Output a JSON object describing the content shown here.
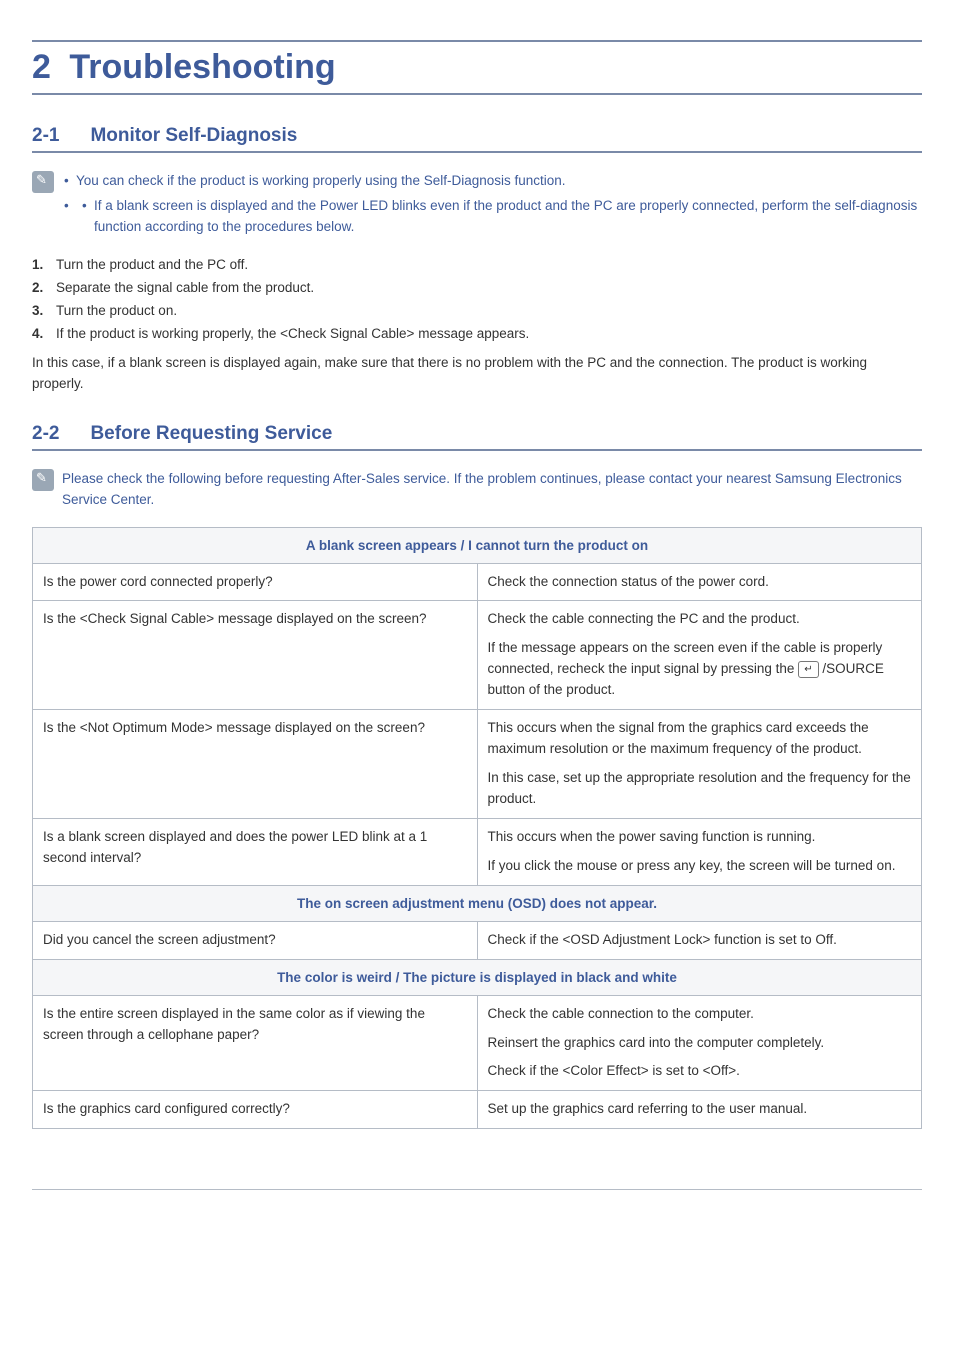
{
  "chapter": {
    "number": "2",
    "title": "Troubleshooting"
  },
  "section1": {
    "number": "2-1",
    "title": "Monitor Self-Diagnosis",
    "note_bullets": [
      "You can check if the product is working properly using the Self-Diagnosis function.",
      "If a blank screen is displayed and the Power LED blinks even if the product and the PC are properly connected, perform the self-diagnosis function according to the procedures below."
    ],
    "steps": [
      "Turn the product and the PC off.",
      "Separate the signal cable from the product.",
      "Turn the product on.",
      "If the product is working properly, the <Check Signal Cable> message appears."
    ],
    "tail": "In this case, if a blank screen is displayed again, make sure that there is no problem with the PC and the connection. The product is working properly."
  },
  "section2": {
    "number": "2-2",
    "title": "Before Requesting Service",
    "note": "Please check the following before requesting After-Sales service. If the problem continues, please contact your nearest Samsung Electronics Service Center.",
    "groups": [
      {
        "header": "A blank screen appears / I cannot turn the product on",
        "rows": [
          {
            "q": "Is the power cord connected properly?",
            "a": [
              "Check the connection status of the power cord."
            ]
          },
          {
            "q": "Is the <Check Signal Cable> message displayed on the screen?",
            "a": [
              "Check the cable connecting the PC and the product.",
              "If the message appears on the screen even if the cable is properly connected, recheck the input signal by pressing the {SOURCE} /SOURCE button of the product."
            ]
          },
          {
            "q": "Is the <Not Optimum Mode> message displayed on the screen?",
            "a": [
              "This occurs when the signal from the graphics card exceeds the maximum resolution or the maximum frequency of the product.",
              "In this case, set up the appropriate resolution and the frequency for the product."
            ]
          },
          {
            "q": "Is a blank screen displayed and does the power LED blink at a 1 second interval?",
            "a": [
              "This occurs when the power saving function is running.",
              "If you click the mouse or press any key, the screen will be turned on."
            ]
          }
        ]
      },
      {
        "header": "The on screen adjustment menu (OSD) does not appear.",
        "rows": [
          {
            "q": "Did you cancel the screen adjustment?",
            "a": [
              "Check if the <OSD Adjustment Lock> function is set to Off."
            ]
          }
        ]
      },
      {
        "header": "The color is weird / The picture is displayed in black and white",
        "rows": [
          {
            "q": "Is the entire screen displayed in the same color as if viewing the screen through a cellophane paper?",
            "a": [
              "Check the cable connection to the computer.",
              "Reinsert the graphics card into the computer completely.",
              "Check if the <Color Effect> is set to <Off>."
            ]
          },
          {
            "q": "Is the graphics card configured correctly?",
            "a": [
              "Set up the graphics card referring to the user manual."
            ]
          }
        ]
      }
    ]
  }
}
